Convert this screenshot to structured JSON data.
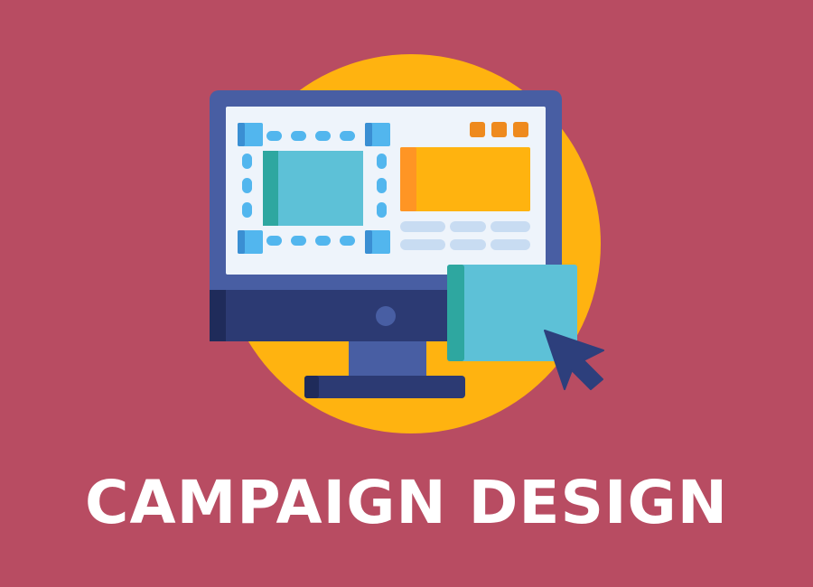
{
  "title": "CAMPAIGN DESIGN",
  "illustration": {
    "icons": [
      "monitor-icon",
      "cursor-arrow-icon"
    ]
  },
  "colors": {
    "background": "#b84c62",
    "circle": "#ffb310",
    "monitor_frame": "#485ea3",
    "monitor_stand_dark": "#2c3a73",
    "screen": "#eef4fb",
    "panel_teal": "#5dc1d7",
    "panel_teal_dark": "#2ea7a0",
    "panel_orange": "#ffb30f",
    "panel_orange_dark": "#ff9524",
    "handle_blue": "#52b6ee",
    "dots_orange": "#ee8a1e",
    "text_lines": "#c8dcf2",
    "cursor": "#2d3f7c",
    "title_text": "#ffffff"
  }
}
